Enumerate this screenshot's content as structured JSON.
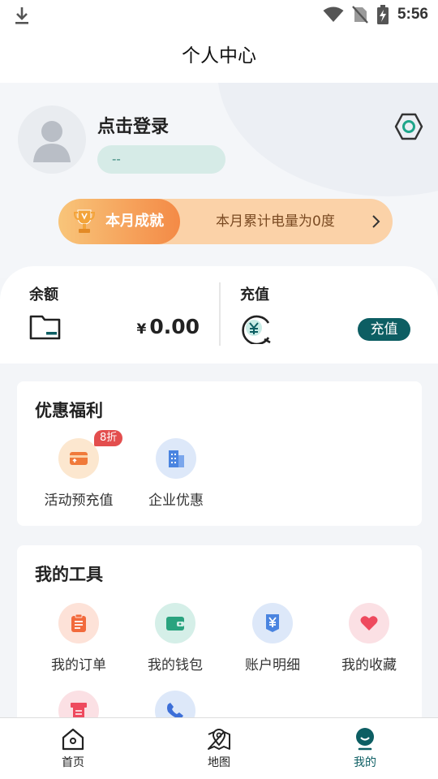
{
  "status_bar": {
    "time": "5:56"
  },
  "header": {
    "title": "个人中心"
  },
  "profile": {
    "login_text": "点击登录",
    "sub_text": "--"
  },
  "achievement": {
    "title": "本月成就",
    "text": "本月累计电量为0度"
  },
  "balance": {
    "label": "余额",
    "currency": "¥",
    "amount": "0.00"
  },
  "recharge": {
    "label": "充值",
    "button": "充值"
  },
  "benefits": {
    "title": "优惠福利",
    "badge": "8折",
    "items": [
      {
        "label": "活动预充值",
        "icon": "card-icon"
      },
      {
        "label": "企业优惠",
        "icon": "building-icon"
      }
    ]
  },
  "tools": {
    "title": "我的工具",
    "items": [
      {
        "label": "我的订单",
        "icon": "clipboard-icon"
      },
      {
        "label": "我的钱包",
        "icon": "wallet-icon"
      },
      {
        "label": "账户明细",
        "icon": "yen-document-icon"
      },
      {
        "label": "我的收藏",
        "icon": "heart-icon"
      },
      {
        "label": "",
        "icon": "receipt-icon"
      },
      {
        "label": "",
        "icon": "phone-icon"
      }
    ]
  },
  "bottom_nav": {
    "items": [
      {
        "label": "首页",
        "icon": "home-icon"
      },
      {
        "label": "地图",
        "icon": "map-icon"
      },
      {
        "label": "我的",
        "icon": "profile-icon"
      }
    ],
    "active": "我的"
  },
  "colors": {
    "accent": "#0d5e63",
    "orange": "#f48a46",
    "badge": "#e34e4e"
  }
}
